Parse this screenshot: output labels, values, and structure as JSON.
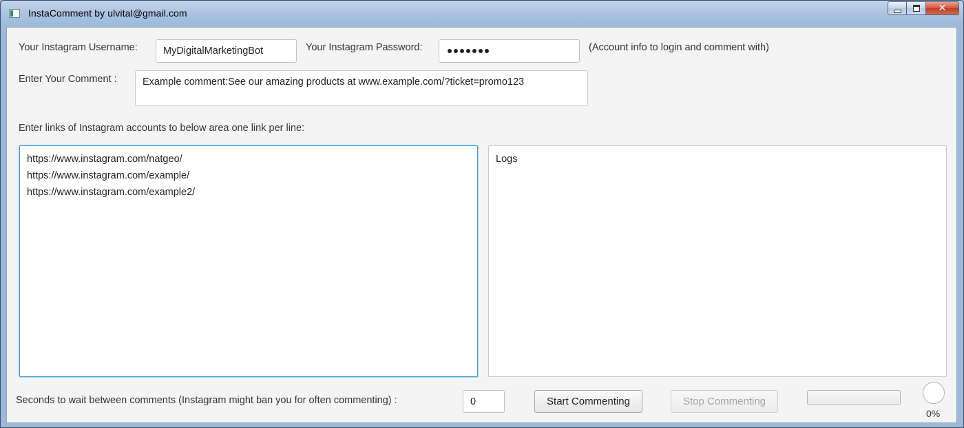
{
  "window": {
    "title": "InstaComment by ulvital@gmail.com",
    "app_icon": "app-window-icon",
    "buttons": {
      "minimize": "minimize-icon",
      "maximize": "maximize-icon",
      "close": "close-icon",
      "close_glyph": "✕"
    }
  },
  "account": {
    "username_label": "Your Instagram Username:",
    "username_value": "MyDigitalMarketingBot",
    "password_label": "Your Instagram Password:",
    "password_length": 7,
    "account_note": "(Account info to login and comment with)"
  },
  "comment": {
    "label": "Enter Your Comment :",
    "value": "Example comment:See our amazing products at www.example.com/?ticket=promo123"
  },
  "links": {
    "label": "Enter links of Instagram accounts to below area one link per line:",
    "items": [
      "https://www.instagram.com/natgeo/",
      "https://www.instagram.com/example/",
      "https://www.instagram.com/example2/"
    ]
  },
  "logs": {
    "text": "Logs"
  },
  "controls": {
    "wait_label": "Seconds to wait between comments (Instagram might ban you for often commenting) :",
    "wait_value": "0",
    "start_label": "Start Commenting",
    "stop_label": "Stop Commenting",
    "progress_fraction": 0,
    "progress_text": "0%"
  },
  "colors": {
    "accent": "#3a9bd9",
    "close_button": "#c23b1f",
    "frame": "#9db8da"
  }
}
